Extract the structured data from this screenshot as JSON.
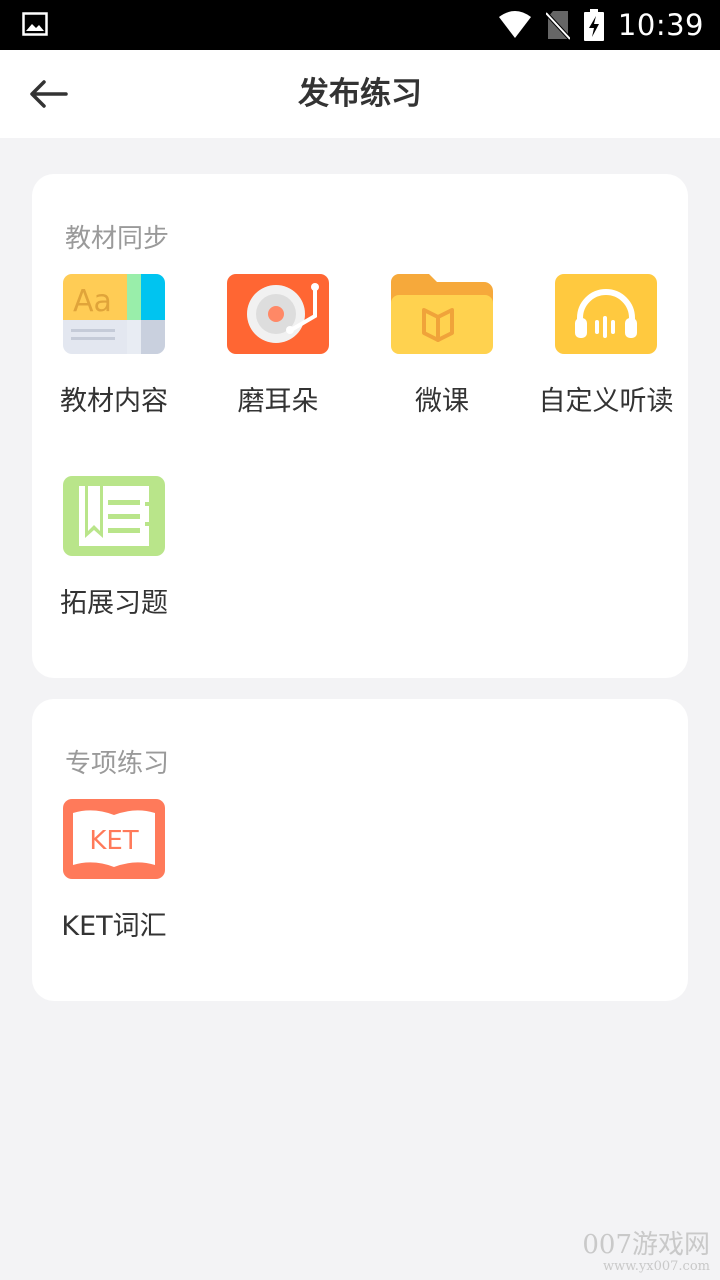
{
  "status_bar": {
    "time": "10:39",
    "icons": [
      "image-icon",
      "wifi-icon",
      "no-sim-icon",
      "battery-charging-icon"
    ]
  },
  "header": {
    "title": "发布练习",
    "back_icon": "back-arrow-icon"
  },
  "sections": [
    {
      "title": "教材同步",
      "items": [
        {
          "label": "教材内容",
          "icon": "textbook-icon"
        },
        {
          "label": "磨耳朵",
          "icon": "record-player-icon"
        },
        {
          "label": "微课",
          "icon": "folder-book-icon"
        },
        {
          "label": "自定义听读",
          "icon": "headphones-icon"
        },
        {
          "label": "拓展习题",
          "icon": "bookmark-list-icon"
        }
      ]
    },
    {
      "title": "专项练习",
      "items": [
        {
          "label": "KET词汇",
          "icon": "ket-book-icon",
          "icon_text": "KET"
        }
      ]
    }
  ],
  "colors": {
    "background": "#f3f3f5",
    "card": "#ffffff",
    "orange": "#ff6633",
    "yellow": "#ffcc44",
    "green": "#b9e58a",
    "ket": "#ff7a5a"
  },
  "watermark": {
    "line1": "007游戏网",
    "line2": "www.yx007.com"
  }
}
